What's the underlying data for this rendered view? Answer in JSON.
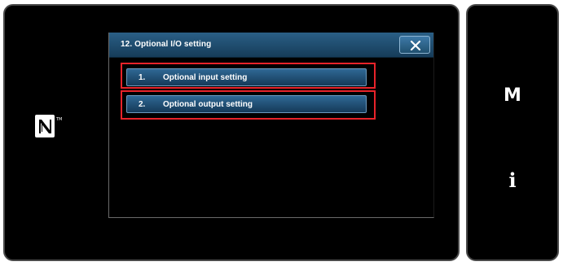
{
  "dialog": {
    "title": "12.  Optional I/O setting",
    "close_icon": "close-icon"
  },
  "menu": {
    "items": [
      {
        "number": "1.",
        "label": "Optional input setting"
      },
      {
        "number": "2.",
        "label": "Optional output setting"
      }
    ]
  },
  "side_panel": {
    "mode_key": "M",
    "info_key": "i"
  },
  "icons": {
    "nfc": "nfc-icon",
    "close": "close-icon"
  },
  "colors": {
    "highlight": "#e8232a",
    "button_blue": "#2f6894",
    "screen_bg": "#000000"
  }
}
